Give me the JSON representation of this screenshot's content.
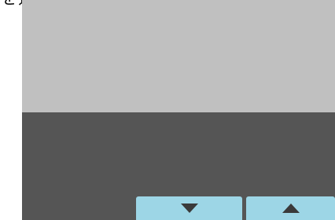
{
  "header": {
    "caption": "を選択。"
  },
  "panel": {
    "upper_color": "#c0c0c0",
    "lower_color": "#555555"
  },
  "controls": {
    "button_color": "#9dd6e6",
    "arrow_color": "#3a3a3a",
    "down_button": {
      "icon": "triangle-down-icon"
    },
    "up_button": {
      "icon": "triangle-up-icon"
    }
  }
}
